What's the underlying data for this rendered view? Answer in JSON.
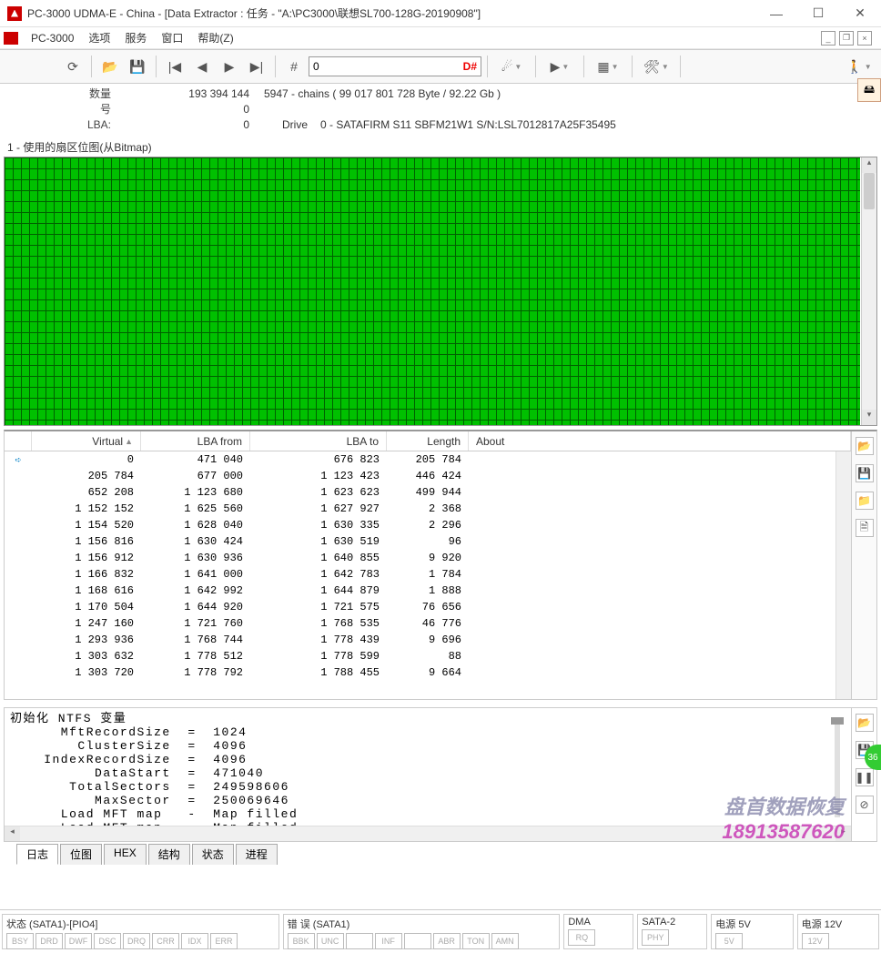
{
  "window": {
    "title": "PC-3000 UDMA-E - China - [Data Extractor : 任务 - \"A:\\PC3000\\联想SL700-128G-20190908\"]"
  },
  "menu": {
    "app": "PC-3000",
    "items": [
      "选项",
      "服务",
      "窗口",
      "帮助(Z)"
    ]
  },
  "toolbar": {
    "input_value": "0",
    "input_badge": "D#"
  },
  "info": {
    "qty_label": "数量",
    "qty_value": "193 394 144",
    "qty_extra": "5947 - chains   ( 99 017 801 728 Byte /   92.22 Gb )",
    "num_label": "号",
    "num_value": "0",
    "lba_label": "LBA:",
    "lba_value": "0",
    "drive_label": "Drive",
    "drive_value": "0 - SATAFIRM   S11 SBFM21W1 S/N:LSL7012817A25F35495"
  },
  "sector": {
    "title": "1 - 使用的扇区位图(从Bitmap)"
  },
  "table": {
    "headers": {
      "virtual": "Virtual",
      "lba_from": "LBA from",
      "lba_to": "LBA to",
      "length": "Length",
      "about": "About"
    },
    "rows": [
      {
        "icon": "➪",
        "virtual": "0",
        "lba_from": "471 040",
        "lba_to": "676 823",
        "length": "205 784"
      },
      {
        "virtual": "205 784",
        "lba_from": "677 000",
        "lba_to": "1 123 423",
        "length": "446 424"
      },
      {
        "virtual": "652 208",
        "lba_from": "1 123 680",
        "lba_to": "1 623 623",
        "length": "499 944"
      },
      {
        "virtual": "1 152 152",
        "lba_from": "1 625 560",
        "lba_to": "1 627 927",
        "length": "2 368"
      },
      {
        "virtual": "1 154 520",
        "lba_from": "1 628 040",
        "lba_to": "1 630 335",
        "length": "2 296"
      },
      {
        "virtual": "1 156 816",
        "lba_from": "1 630 424",
        "lba_to": "1 630 519",
        "length": "96"
      },
      {
        "virtual": "1 156 912",
        "lba_from": "1 630 936",
        "lba_to": "1 640 855",
        "length": "9 920"
      },
      {
        "virtual": "1 166 832",
        "lba_from": "1 641 000",
        "lba_to": "1 642 783",
        "length": "1 784"
      },
      {
        "virtual": "1 168 616",
        "lba_from": "1 642 992",
        "lba_to": "1 644 879",
        "length": "1 888"
      },
      {
        "virtual": "1 170 504",
        "lba_from": "1 644 920",
        "lba_to": "1 721 575",
        "length": "76 656"
      },
      {
        "virtual": "1 247 160",
        "lba_from": "1 721 760",
        "lba_to": "1 768 535",
        "length": "46 776"
      },
      {
        "virtual": "1 293 936",
        "lba_from": "1 768 744",
        "lba_to": "1 778 439",
        "length": "9 696"
      },
      {
        "virtual": "1 303 632",
        "lba_from": "1 778 512",
        "lba_to": "1 778 599",
        "length": "88"
      },
      {
        "virtual": "1 303 720",
        "lba_from": "1 778 792",
        "lba_to": "1 788 455",
        "length": "9 664"
      }
    ]
  },
  "log": {
    "lines": [
      "初始化 NTFS 变量",
      "      MftRecordSize  =  1024",
      "        ClusterSize  =  4096",
      "    IndexRecordSize  =  4096",
      "          DataStart  =  471040",
      "       TotalSectors  =  249598606",
      "          MaxSector  =  250069646",
      "      Load MFT map   -  Map filled",
      "      Load MFT map   -  Map filled"
    ]
  },
  "tabs": {
    "items": [
      "日志",
      "位图",
      "HEX",
      "结构",
      "状态",
      "进程"
    ],
    "active": 0
  },
  "status": {
    "g1_label": "状态 (SATA1)-[PIO4]",
    "g1": [
      "BSY",
      "DRD",
      "DWF",
      "DSC",
      "DRQ",
      "CRR",
      "IDX",
      "ERR"
    ],
    "g2_label": "错 误 (SATA1)",
    "g2": [
      "BBK",
      "UNC",
      "",
      "INF",
      "",
      "ABR",
      "TON",
      "AMN"
    ],
    "g3_label": "DMA",
    "g3": [
      "RQ"
    ],
    "g4_label": "SATA-2",
    "g4": [
      "PHY"
    ],
    "g5_label": "电源 5V",
    "g5": [
      "5V"
    ],
    "g6_label": "电源 12V",
    "g6": [
      "12V"
    ]
  },
  "watermark": {
    "line1": "盘首数据恢复",
    "line2": "18913587620"
  },
  "greendot": "36"
}
